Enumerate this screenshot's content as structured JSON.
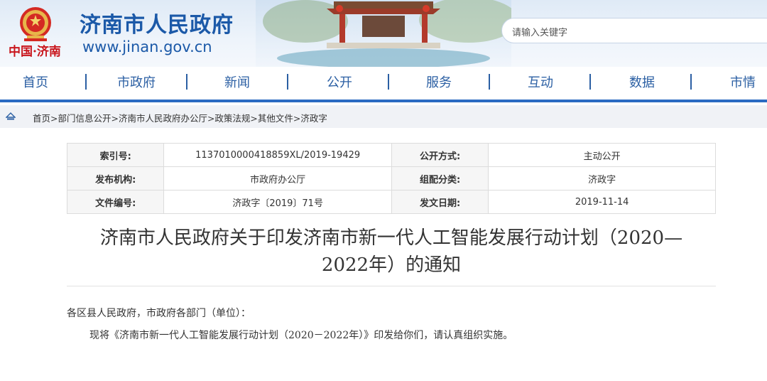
{
  "header": {
    "site_title": "济南市人民政府",
    "site_url": "www.jinan.gov.cn",
    "emblem_caption": "中国·济南",
    "search_placeholder": "请输入关键字"
  },
  "nav": {
    "items": [
      "首页",
      "市政府",
      "新闻",
      "公开",
      "服务",
      "互动",
      "数据",
      "市情"
    ]
  },
  "breadcrumb": {
    "text": "首页>部门信息公开>济南市人民政府办公厅>政策法规>其他文件>济政字"
  },
  "meta": {
    "index_label": "索引号:",
    "index_value": "1137010000418859XL/2019-19429",
    "disclosure_label": "公开方式:",
    "disclosure_value": "主动公开",
    "publisher_label": "发布机构:",
    "publisher_value": "市政府办公厅",
    "category_label": "组配分类:",
    "category_value": "济政字",
    "docno_label": "文件编号:",
    "docno_value": "济政字〔2019〕71号",
    "date_label": "发文日期:",
    "date_value": "2019-11-14"
  },
  "document": {
    "title_line1": "济南市人民政府关于印发济南市新一代人工智能发展行动计划（2020—",
    "title_line2": "2022年）的通知",
    "salutation": "各区县人民政府，市政府各部门（单位）：",
    "body": "现将《济南市新一代人工智能发展行动计划（2020－2022年）》印发给你们，请认真组织实施。"
  },
  "colors": {
    "brand_blue": "#1b59a8",
    "nav_blue": "#2b5fa3",
    "emblem_red": "#c9161d"
  }
}
